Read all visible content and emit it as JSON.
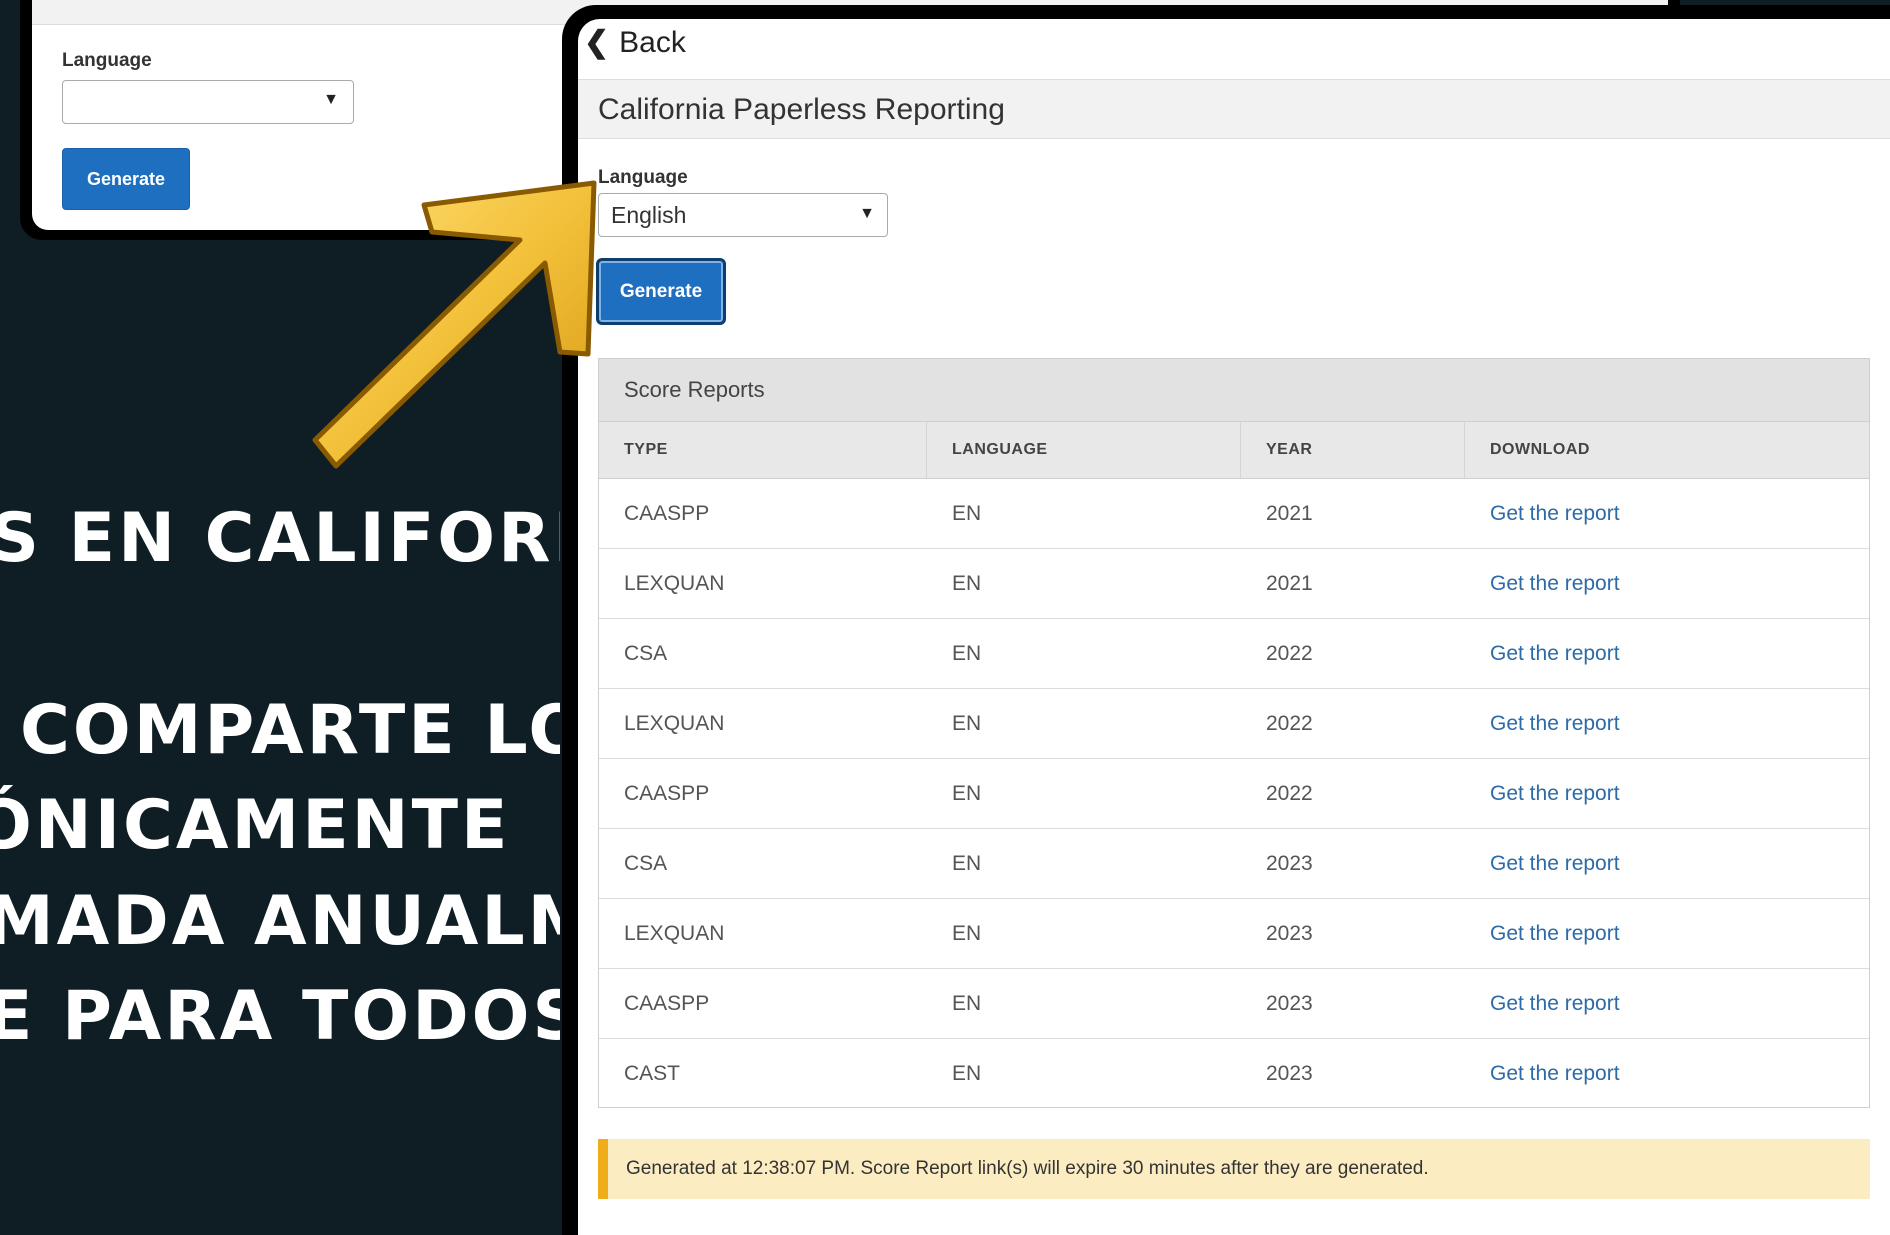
{
  "background_panel": {
    "language_label": "Language",
    "generate_label": "Generate"
  },
  "spanish_text": {
    "line1": "S EN CALIFORNIA",
    "line2": "COMPARTE LOS",
    "line3": "ÓNICAMENTE",
    "line4": "MADA ANUALMENTE",
    "line5": "E PARA TODOS LOS"
  },
  "colors": {
    "dark_background": "#0e1e24",
    "arrow_gold": "#f3c13a",
    "button_blue": "#1f6fc0",
    "link_blue": "#2d6aa8",
    "notice_bg": "#fbecc2",
    "notice_accent": "#f0ad1a"
  },
  "main": {
    "back_label": "Back",
    "title": "California Paperless Reporting",
    "language_label": "Language",
    "language_value": "English",
    "generate_label": "Generate",
    "score_reports": {
      "heading": "Score Reports",
      "columns": [
        "TYPE",
        "LANGUAGE",
        "YEAR",
        "DOWNLOAD"
      ],
      "rows": [
        {
          "type": "CAASPP",
          "language": "EN",
          "year": "2021",
          "download": "Get the report"
        },
        {
          "type": "LEXQUAN",
          "language": "EN",
          "year": "2021",
          "download": "Get the report"
        },
        {
          "type": "CSA",
          "language": "EN",
          "year": "2022",
          "download": "Get the report"
        },
        {
          "type": "LEXQUAN",
          "language": "EN",
          "year": "2022",
          "download": "Get the report"
        },
        {
          "type": "CAASPP",
          "language": "EN",
          "year": "2022",
          "download": "Get the report"
        },
        {
          "type": "CSA",
          "language": "EN",
          "year": "2023",
          "download": "Get the report"
        },
        {
          "type": "LEXQUAN",
          "language": "EN",
          "year": "2023",
          "download": "Get the report"
        },
        {
          "type": "CAASPP",
          "language": "EN",
          "year": "2023",
          "download": "Get the report"
        },
        {
          "type": "CAST",
          "language": "EN",
          "year": "2023",
          "download": "Get the report"
        }
      ]
    },
    "notice": "Generated at 12:38:07 PM. Score Report link(s) will expire 30 minutes after they are generated."
  }
}
